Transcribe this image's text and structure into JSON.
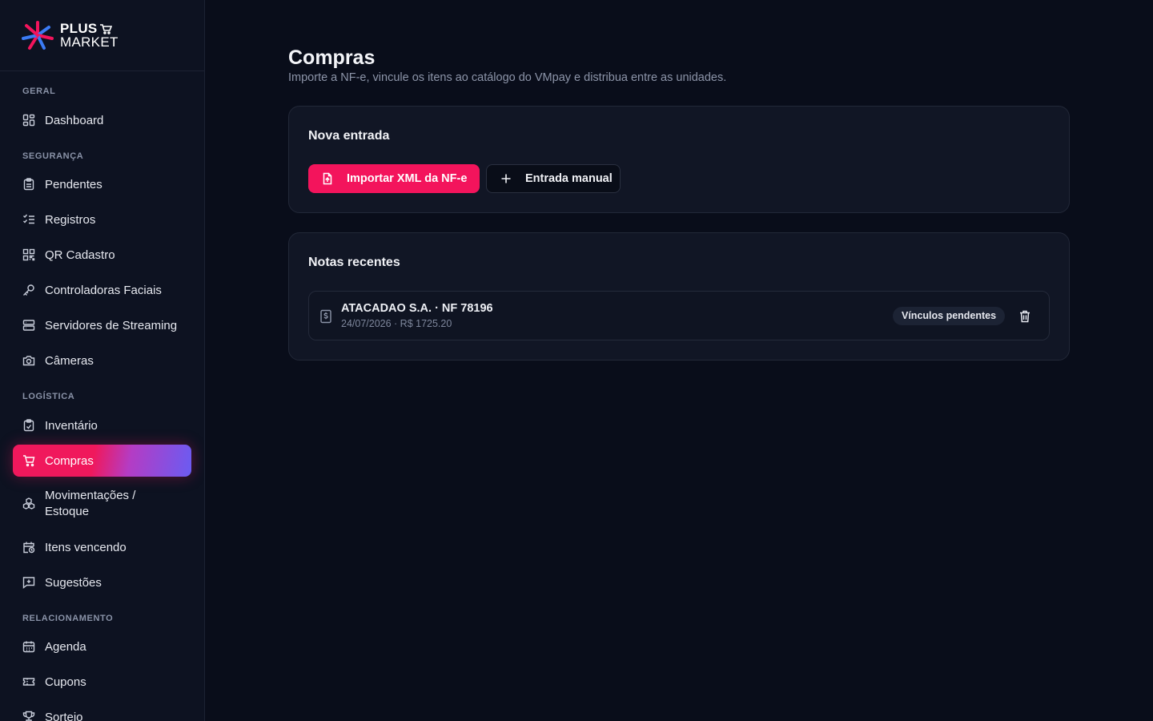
{
  "brand": {
    "line1": "PLUS",
    "line2": "MARKET"
  },
  "sidebar": {
    "sections": [
      {
        "label": "GERAL"
      },
      {
        "label": "SEGURANÇA"
      },
      {
        "label": "LOGÍSTICA"
      },
      {
        "label": "RELACIONAMENTO"
      }
    ],
    "items": [
      {
        "label": "Dashboard",
        "icon": "dashboard-icon"
      },
      {
        "label": "Pendentes",
        "icon": "clipboard-icon"
      },
      {
        "label": "Registros",
        "icon": "list-check-icon"
      },
      {
        "label": "QR Cadastro",
        "icon": "qr-code-icon"
      },
      {
        "label": "Controladoras Faciais",
        "icon": "key-icon"
      },
      {
        "label": "Servidores de Streaming",
        "icon": "server-icon"
      },
      {
        "label": "Câmeras",
        "icon": "camera-icon"
      },
      {
        "label": "Inventário",
        "icon": "clipboard-check-icon"
      },
      {
        "label": "Compras",
        "icon": "cart-icon",
        "active": true
      },
      {
        "label_line1": "Movimentações /",
        "label_line2": "Estoque",
        "icon": "boxes-icon"
      },
      {
        "label": "Itens vencendo",
        "icon": "calendar-clock-icon"
      },
      {
        "label": "Sugestões",
        "icon": "message-plus-icon"
      },
      {
        "label": "Agenda",
        "icon": "calendar-icon"
      },
      {
        "label": "Cupons",
        "icon": "ticket-icon"
      },
      {
        "label": "Sorteio",
        "icon": "trophy-icon"
      }
    ]
  },
  "page": {
    "title": "Compras",
    "subtitle": "Importe a NF-e, vincule os itens ao catálogo do VMpay e distribua entre as unidades."
  },
  "new_entry": {
    "title": "Nova entrada",
    "import_label": "Importar XML da NF-e",
    "manual_label": "Entrada manual"
  },
  "recent": {
    "title": "Notas recentes",
    "notes": [
      {
        "title": "ATACADAO S.A. · NF 78196",
        "meta": "24/07/2026 · R$ 1725.20",
        "status": "Vínculos pendentes"
      }
    ]
  },
  "colors": {
    "accent": "#f3145c",
    "gradient_end": "#6a5cf2",
    "background": "#090d1a",
    "sidebar": "#0d1221",
    "card": "#111625"
  }
}
